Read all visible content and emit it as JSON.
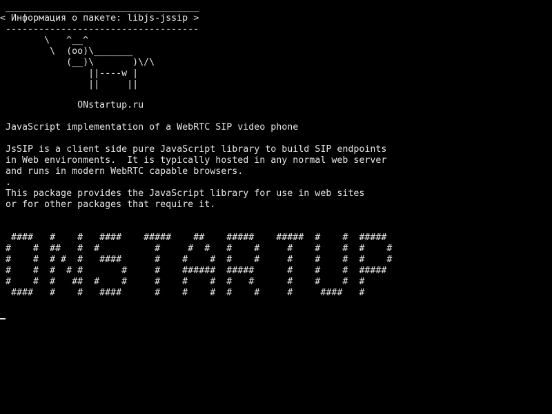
{
  "terminal": {
    "cowsay": " ___________________________________\n< Информация о пакете: libjs-jssip >\n -----------------------------------\n        \\   ^__^\n         \\  (oo)\\_______\n            (__)\\       )\\/\\\n                ||----w |\n                ||     ||",
    "brand": "              ONstartup.ru",
    "summary": " JavaScript implementation of a WebRTC SIP video phone",
    "description": " JsSIP is a client side pure JavaScript library to build SIP endpoints\n in Web environments.  It is typically hosted in any normal web server\n and runs in modern WebRTC capable browsers.\n .\n This package provides the JavaScript library for use in web sites\n or for other packages that require it.",
    "banner": "  ####   #    #   ####    #####    ##    #####    #####  #    #  #####\n #    #  ##   #  #          #     #  #   #    #     #    #    #  #    #\n #    #  # #  #   ####      #    #    #  #    #     #    #    #  #    #\n #    #  #  # #       #     #    ######  #####      #    #    #  #####\n #    #  #   ##  #    #     #    #    #  #   #      #    #    #  #\n  ####   #    #   ####      #    #    #  #    #     #     ####   #"
  },
  "colors": {
    "background": "#000000",
    "foreground": "#e6e6e6"
  }
}
